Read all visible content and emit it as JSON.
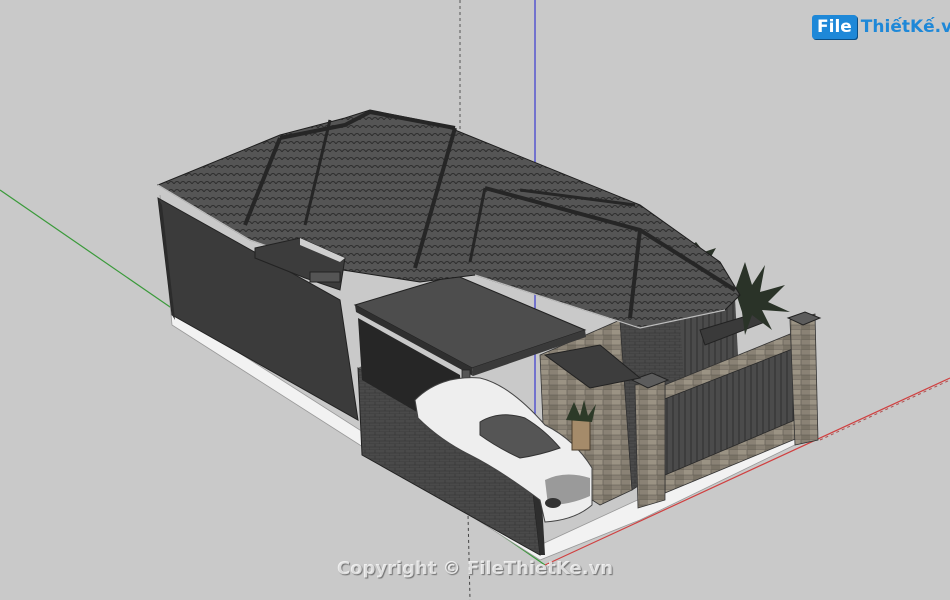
{
  "logo": {
    "badge": "File",
    "text": "ThiếtKế.vn"
  },
  "watermark": {
    "text": "Copyright © FileThietKe.vn"
  },
  "colors": {
    "background": "#c9c9c9",
    "roof": "#4e4e4e",
    "wall": "#3f3f3f",
    "stone": "#8a8275",
    "car": "#eeeeee",
    "axis_red": "#d04040",
    "axis_green": "#3a9a3a",
    "axis_blue": "#3a3ad0",
    "brand": "#1e88d8"
  }
}
